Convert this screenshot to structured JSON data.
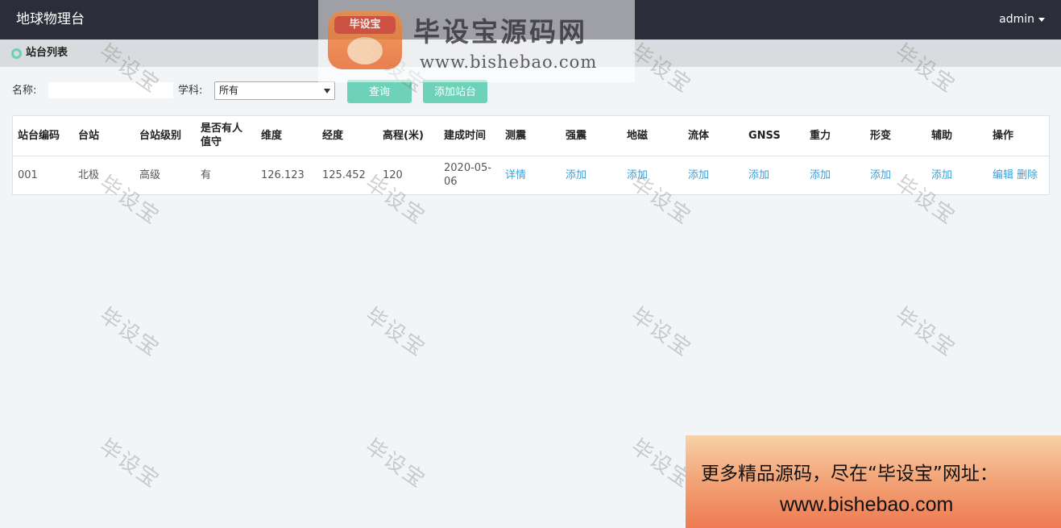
{
  "navbar": {
    "brand": "地球物理台",
    "user": "admin"
  },
  "section": {
    "title": "站台列表"
  },
  "filters": {
    "name_label": "名称:",
    "name_value": "",
    "subject_label": "学科:",
    "subject_selected": "所有",
    "query_button": "查询",
    "add_button": "添加站台"
  },
  "table": {
    "headers": [
      "站台编码",
      "台站",
      "台站级别",
      "是否有人值守",
      "维度",
      "经度",
      "高程(米)",
      "建成时间",
      "测震",
      "强震",
      "地磁",
      "流体",
      "GNSS",
      "重力",
      "形变",
      "辅助",
      "操作"
    ],
    "rows": [
      {
        "code": "001",
        "station": "北极",
        "level": "高级",
        "staffed": "有",
        "lat": "126.123",
        "lng": "125.452",
        "elevation": "120",
        "built": "2020-05-06",
        "seismic": "详情",
        "strong_motion": "添加",
        "geomagnetic": "添加",
        "fluid": "添加",
        "gnss": "添加",
        "gravity": "添加",
        "deformation": "添加",
        "auxiliary": "添加",
        "edit": "编辑",
        "delete": "删除"
      }
    ]
  },
  "watermark": {
    "text": "毕设宝"
  },
  "logo": {
    "badge": "毕设宝",
    "title": "毕设宝源码网",
    "url": "www.bishebao.com"
  },
  "promo": {
    "line1": "更多精品源码，尽在“毕设宝”网址：",
    "line2": "www.bishebao.com"
  },
  "colors": {
    "navbar": "#2b2d3a",
    "accent": "#6dd2b7",
    "link": "#3aa0d8"
  }
}
